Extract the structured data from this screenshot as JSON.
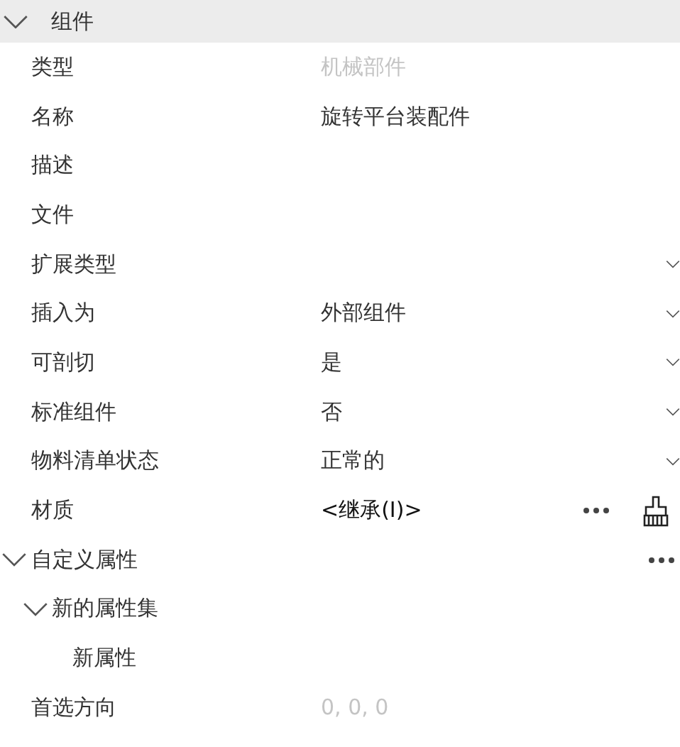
{
  "section": {
    "title": "组件",
    "expanded": true
  },
  "properties": [
    {
      "kind": "text",
      "label": "类型",
      "value": "机械部件",
      "disabled": true
    },
    {
      "kind": "text",
      "label": "名称",
      "value": "旋转平台装配件",
      "disabled": false
    },
    {
      "kind": "text",
      "label": "描述"
    },
    {
      "kind": "text",
      "label": "文件"
    },
    {
      "kind": "dropdown",
      "label": "扩展类型"
    },
    {
      "kind": "dropdown",
      "label": "插入为",
      "value": "外部组件"
    },
    {
      "kind": "dropdown",
      "label": "可剖切",
      "value": "是"
    },
    {
      "kind": "dropdown",
      "label": "标准组件",
      "value": "否"
    },
    {
      "kind": "dropdown",
      "label": "物料清单状态",
      "value": "正常的"
    },
    {
      "kind": "material",
      "label": "材质",
      "value": "<继承(I)>"
    },
    {
      "kind": "group",
      "label": "自定义属性",
      "expanded": true,
      "children": [
        {
          "kind": "group",
          "label": "新的属性集",
          "expanded": true,
          "children": [
            {
              "kind": "text",
              "label": "新属性"
            }
          ]
        }
      ]
    },
    {
      "kind": "text",
      "label": "首选方向",
      "value": "0, 0, 0",
      "disabled": true
    }
  ]
}
